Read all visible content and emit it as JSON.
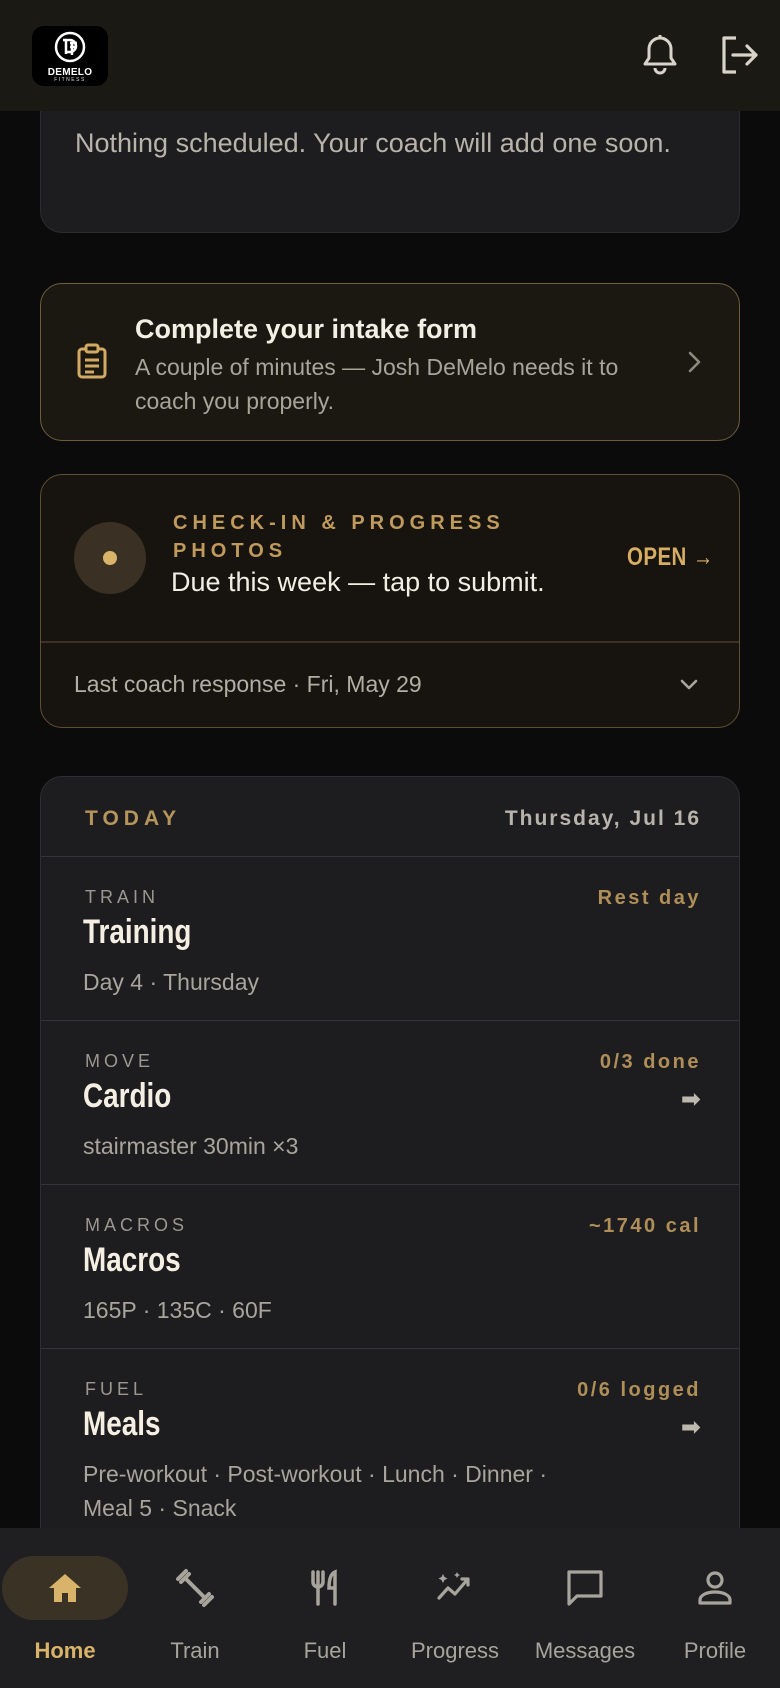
{
  "header": {
    "logo_text": "DEMELO",
    "logo_sub": "FITNESS",
    "icons": [
      "bell-icon",
      "logout-icon"
    ]
  },
  "schedule": {
    "empty_text": "Nothing scheduled. Your coach will add one soon."
  },
  "intake": {
    "icon": "clipboard-icon",
    "title": "Complete your intake form",
    "description": "A couple of minutes — Josh DeMelo  needs it to coach you properly."
  },
  "checkin": {
    "eyebrow": "CHECK-IN & PROGRESS PHOTOS",
    "due_text": "Due this week — tap to submit.",
    "open_label": "OPEN →",
    "last_response": "Last coach response · Fri, May 29"
  },
  "today": {
    "label": "TODAY",
    "date": "Thursday, Jul 16",
    "rows": [
      {
        "eyebrow": "TRAIN",
        "title": "Training",
        "sub": "Day 4 · Thursday",
        "status": "Rest day",
        "arrow": ""
      },
      {
        "eyebrow": "MOVE",
        "title": "Cardio",
        "sub": "stairmaster 30min ×3",
        "status": "0/3 done",
        "arrow": "➡"
      },
      {
        "eyebrow": "MACROS",
        "title": "Macros",
        "sub": "165P · 135C · 60F",
        "status": "~1740 cal",
        "arrow": ""
      },
      {
        "eyebrow": "FUEL",
        "title": "Meals",
        "sub": "Pre-workout · Post-workout · Lunch · Dinner · Meal 5 · Snack",
        "status": "0/6 logged",
        "arrow": "➡"
      }
    ]
  },
  "nav": {
    "items": [
      {
        "label": "Home",
        "icon": "home-icon",
        "active": true
      },
      {
        "label": "Train",
        "icon": "dumbbell-icon",
        "active": false
      },
      {
        "label": "Fuel",
        "icon": "utensils-icon",
        "active": false
      },
      {
        "label": "Progress",
        "icon": "progress-icon",
        "active": false
      },
      {
        "label": "Messages",
        "icon": "message-icon",
        "active": false
      },
      {
        "label": "Profile",
        "icon": "profile-icon",
        "active": false
      }
    ]
  },
  "colors": {
    "accent": "#d9b36a",
    "background": "#0b0b0b",
    "card": "#1d1d20"
  }
}
